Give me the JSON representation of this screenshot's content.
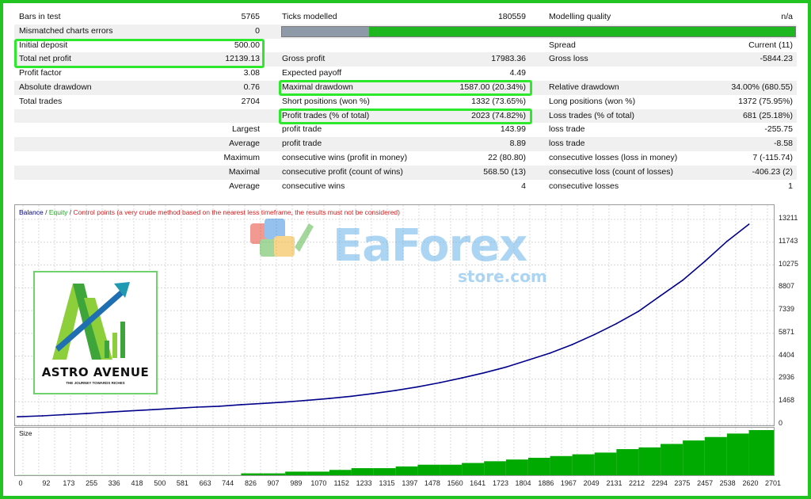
{
  "stats": {
    "bars_label": "Bars in test",
    "bars_value": "5765",
    "ticks_label": "Ticks modelled",
    "ticks_value": "180559",
    "quality_label": "Modelling quality",
    "quality_value": "n/a",
    "mismatch_label": "Mismatched charts errors",
    "mismatch_value": "0",
    "deposit_label": "Initial deposit",
    "deposit_value": "500.00",
    "spread_label": "Spread",
    "spread_value": "Current (11)",
    "net_label": "Total net profit",
    "net_value": "12139.13",
    "gross_profit_label": "Gross profit",
    "gross_profit_value": "17983.36",
    "gross_loss_label": "Gross loss",
    "gross_loss_value": "-5844.23",
    "pf_label": "Profit factor",
    "pf_value": "3.08",
    "ep_label": "Expected payoff",
    "ep_value": "4.49",
    "abs_dd_label": "Absolute drawdown",
    "abs_dd_value": "0.76",
    "max_dd_label": "Maximal drawdown",
    "max_dd_value": "1587.00 (20.34%)",
    "rel_dd_label": "Relative drawdown",
    "rel_dd_value": "34.00% (680.55)",
    "trades_label": "Total trades",
    "trades_value": "2704",
    "short_label": "Short positions (won %)",
    "short_value": "1332 (73.65%)",
    "long_label": "Long positions (won %)",
    "long_value": "1372 (75.95%)",
    "pt_label": "Profit trades (% of total)",
    "pt_value": "2023 (74.82%)",
    "lt_label": "Loss trades (% of total)",
    "lt_value": "681 (25.18%)",
    "largest_label": "Largest",
    "largest_pt_label": "profit trade",
    "largest_pt_value": "143.99",
    "largest_lt_label": "loss trade",
    "largest_lt_value": "-255.75",
    "average_label": "Average",
    "average_pt_label": "profit trade",
    "average_pt_value": "8.89",
    "average_lt_label": "loss trade",
    "average_lt_value": "-8.58",
    "maximum_label": "Maximum",
    "max_cw_label": "consecutive wins (profit in money)",
    "max_cw_value": "22 (80.80)",
    "max_cl_label": "consecutive losses (loss in money)",
    "max_cl_value": "7 (-115.74)",
    "maximal_label": "Maximal",
    "mxl_cp_label": "consecutive profit (count of wins)",
    "mxl_cp_value": "568.50 (13)",
    "mxl_cl_label": "consecutive loss (count of losses)",
    "mxl_cl_value": "-406.23 (2)",
    "avg2_label": "Average",
    "avg_cw_label": "consecutive wins",
    "avg_cw_value": "4",
    "avg_cl_label": "consecutive losses",
    "avg_cl_value": "1",
    "quality_fill_fraction": 0.17
  },
  "legend": {
    "balance": "Balance",
    "sep1": " / ",
    "equity": "Equity",
    "sep2": " / ",
    "control": "Control points (a very crude method based on the nearest less timeframe, the results must not be considered)"
  },
  "size_label": "Size",
  "watermark": {
    "title": "EaForex",
    "subtitle": "store.com"
  },
  "logo": {
    "name": "ASTRO AVENUE",
    "tagline": "THE JOURNEY TOWARDS RICHES"
  },
  "colors": {
    "highlight": "#2ee82e",
    "balance": "#00008b",
    "equity": "#1fa81f",
    "size_bar": "#00aa00",
    "quality_bar": "#1fb71f"
  },
  "chart_data": [
    {
      "type": "line",
      "series": [
        {
          "name": "Balance",
          "x": [
            0,
            92,
            173,
            255,
            336,
            418,
            500,
            581,
            663,
            744,
            826,
            907,
            989,
            1070,
            1152,
            1233,
            1315,
            1397,
            1478,
            1560,
            1641,
            1723,
            1804,
            1886,
            1967,
            2049,
            2131,
            2212,
            2294,
            2375,
            2457,
            2538,
            2620,
            2701
          ],
          "values": [
            500,
            560,
            640,
            710,
            800,
            880,
            960,
            1040,
            1120,
            1180,
            1280,
            1360,
            1450,
            1560,
            1680,
            1820,
            2000,
            2200,
            2430,
            2700,
            3000,
            3330,
            3700,
            4150,
            4600,
            5150,
            5800,
            6500,
            7300,
            8300,
            9300,
            10500,
            11800,
            12900
          ]
        }
      ],
      "yticks": [
        0,
        1468,
        2936,
        4404,
        5871,
        7339,
        8807,
        10275,
        11743,
        13211
      ],
      "ylim": [
        0,
        13211
      ],
      "grid": true
    },
    {
      "type": "bar",
      "title": "Size",
      "x": [
        0,
        92,
        173,
        255,
        336,
        418,
        500,
        581,
        663,
        744,
        826,
        907,
        989,
        1070,
        1152,
        1233,
        1315,
        1397,
        1478,
        1560,
        1641,
        1723,
        1804,
        1886,
        1967,
        2049,
        2131,
        2212,
        2294,
        2375,
        2457,
        2538,
        2620,
        2701
      ],
      "values": [
        0.01,
        0.01,
        0.01,
        0.01,
        0.01,
        0.01,
        0.01,
        0.01,
        0.01,
        0.01,
        0.02,
        0.02,
        0.03,
        0.03,
        0.04,
        0.05,
        0.05,
        0.06,
        0.07,
        0.07,
        0.08,
        0.09,
        0.1,
        0.11,
        0.12,
        0.13,
        0.14,
        0.16,
        0.17,
        0.19,
        0.21,
        0.23,
        0.25,
        0.27
      ],
      "xticks": [
        0,
        92,
        173,
        255,
        336,
        418,
        500,
        581,
        663,
        744,
        826,
        907,
        989,
        1070,
        1152,
        1233,
        1315,
        1397,
        1478,
        1560,
        1641,
        1723,
        1804,
        1886,
        1967,
        2049,
        2131,
        2212,
        2294,
        2375,
        2457,
        2538,
        2620,
        2701
      ]
    }
  ]
}
